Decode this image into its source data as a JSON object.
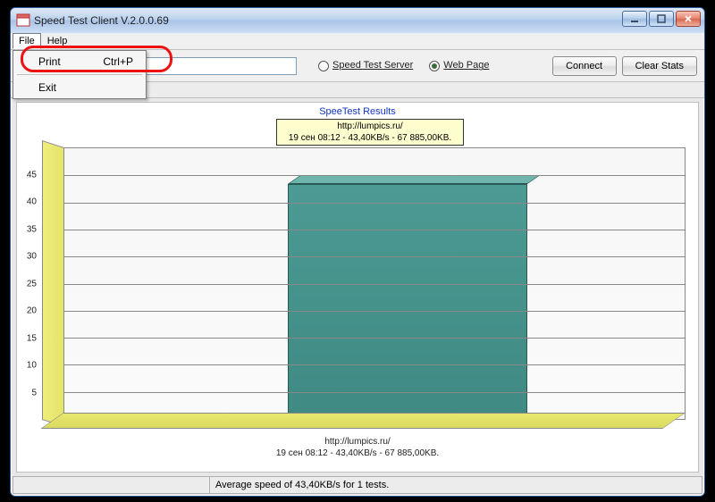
{
  "window": {
    "title": "Speed Test Client V.2.0.0.69"
  },
  "menubar": {
    "file": "File",
    "help": "Help"
  },
  "file_menu": {
    "print_label": "Print",
    "print_shortcut": "Ctrl+P",
    "exit_label": "Exit"
  },
  "toolbar": {
    "address_value": "",
    "radio_server": "Speed Test Server",
    "radio_webpage": "Web Page",
    "connect": "Connect",
    "clear_stats": "Clear Stats"
  },
  "chart_data": {
    "type": "bar",
    "title": "SpeeTest Results",
    "categories": [
      "http://lumpics.ru/"
    ],
    "values": [
      43.4
    ],
    "ylim": [
      0,
      50
    ],
    "yticks": [
      5,
      10,
      15,
      20,
      25,
      30,
      35,
      40,
      45
    ],
    "tooltip_line1": "http://lumpics.ru/",
    "tooltip_line2": "19 сен 08:12 - 43,40KB/s - 67 885,00KB.",
    "xlabel_line1": "http://lumpics.ru/",
    "xlabel_line2": "19 сен 08:12 - 43,40KB/s - 67 885,00KB."
  },
  "statusbar": {
    "text": "Average speed of 43,40KB/s for 1 tests."
  }
}
